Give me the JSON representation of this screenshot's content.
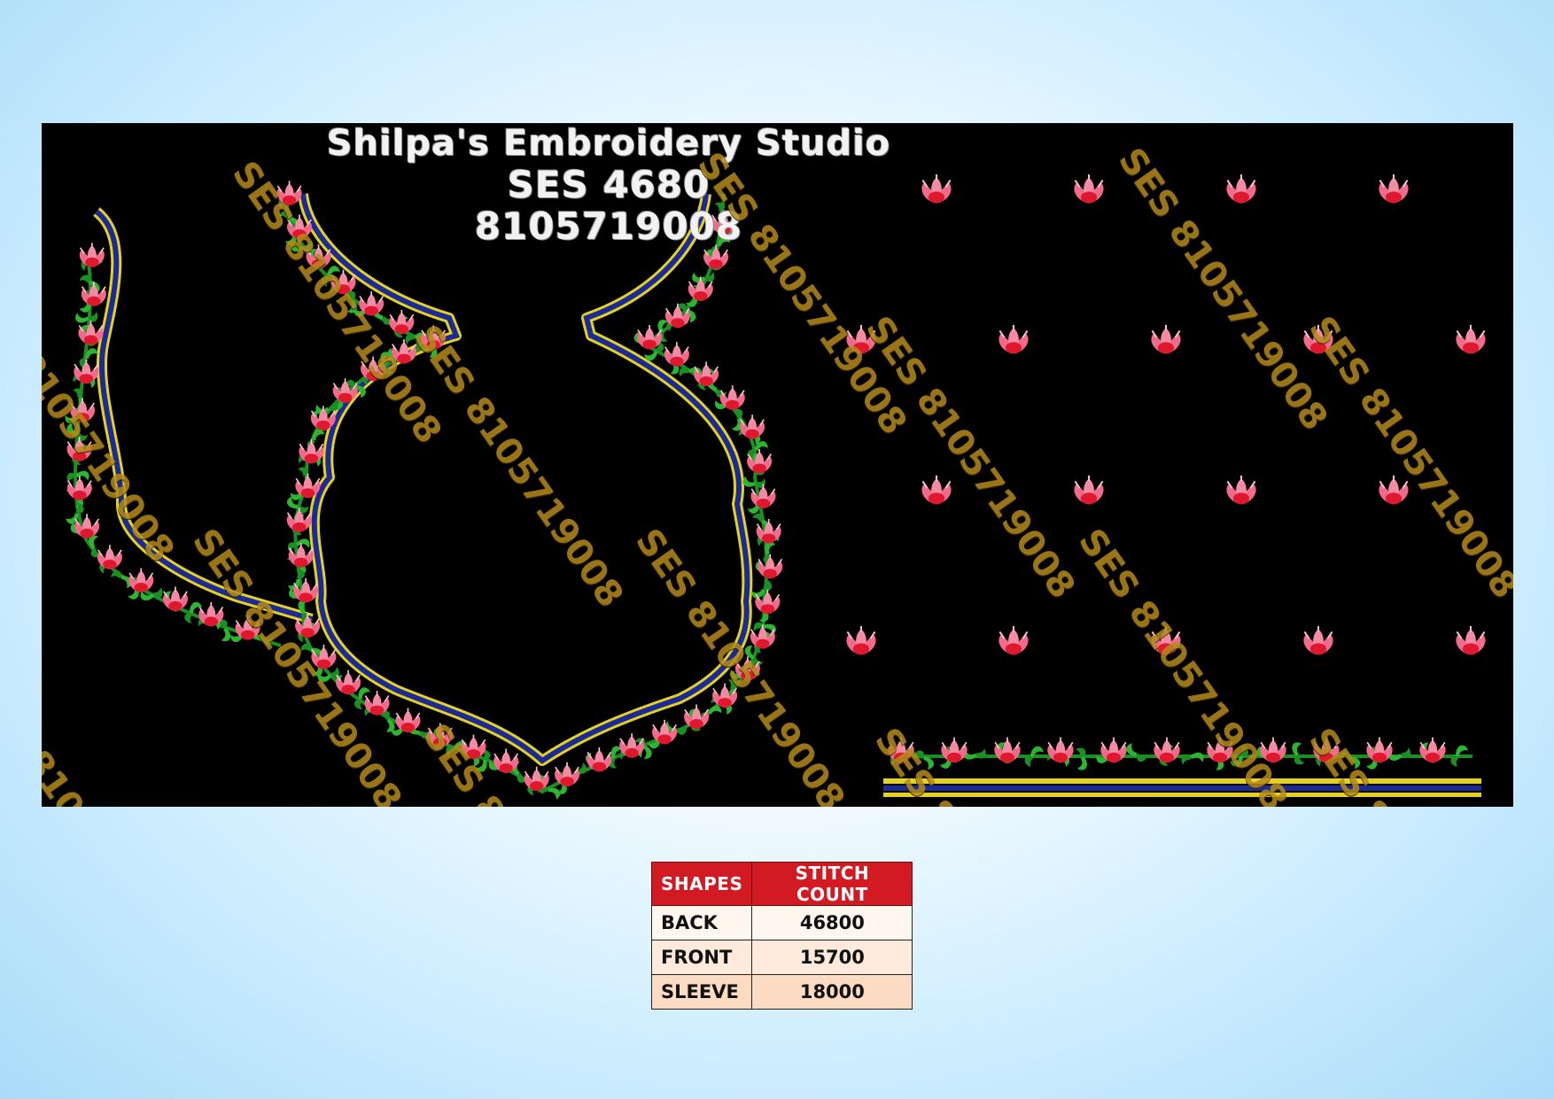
{
  "header": {
    "studio": "Shilpa's Embroidery Studio",
    "design_code": "SES 4680",
    "phone": "8105719008"
  },
  "watermark": "SES 8105719008",
  "watermark_short": "8105719008",
  "colors": {
    "background": "#000000",
    "vine_green": "#22a82a",
    "flower_pink": "#f06a8a",
    "flower_red": "#e0182e",
    "border_yellow": "#e6d21c",
    "border_blue": "#1a2a9a",
    "table_header": "#d21a22"
  },
  "table": {
    "headers": [
      "SHAPES",
      "STITCH COUNT"
    ],
    "rows": [
      {
        "shape": "BACK",
        "count": "46800"
      },
      {
        "shape": "FRONT",
        "count": "15700"
      },
      {
        "shape": "SLEEVE",
        "count": "18000"
      }
    ]
  }
}
